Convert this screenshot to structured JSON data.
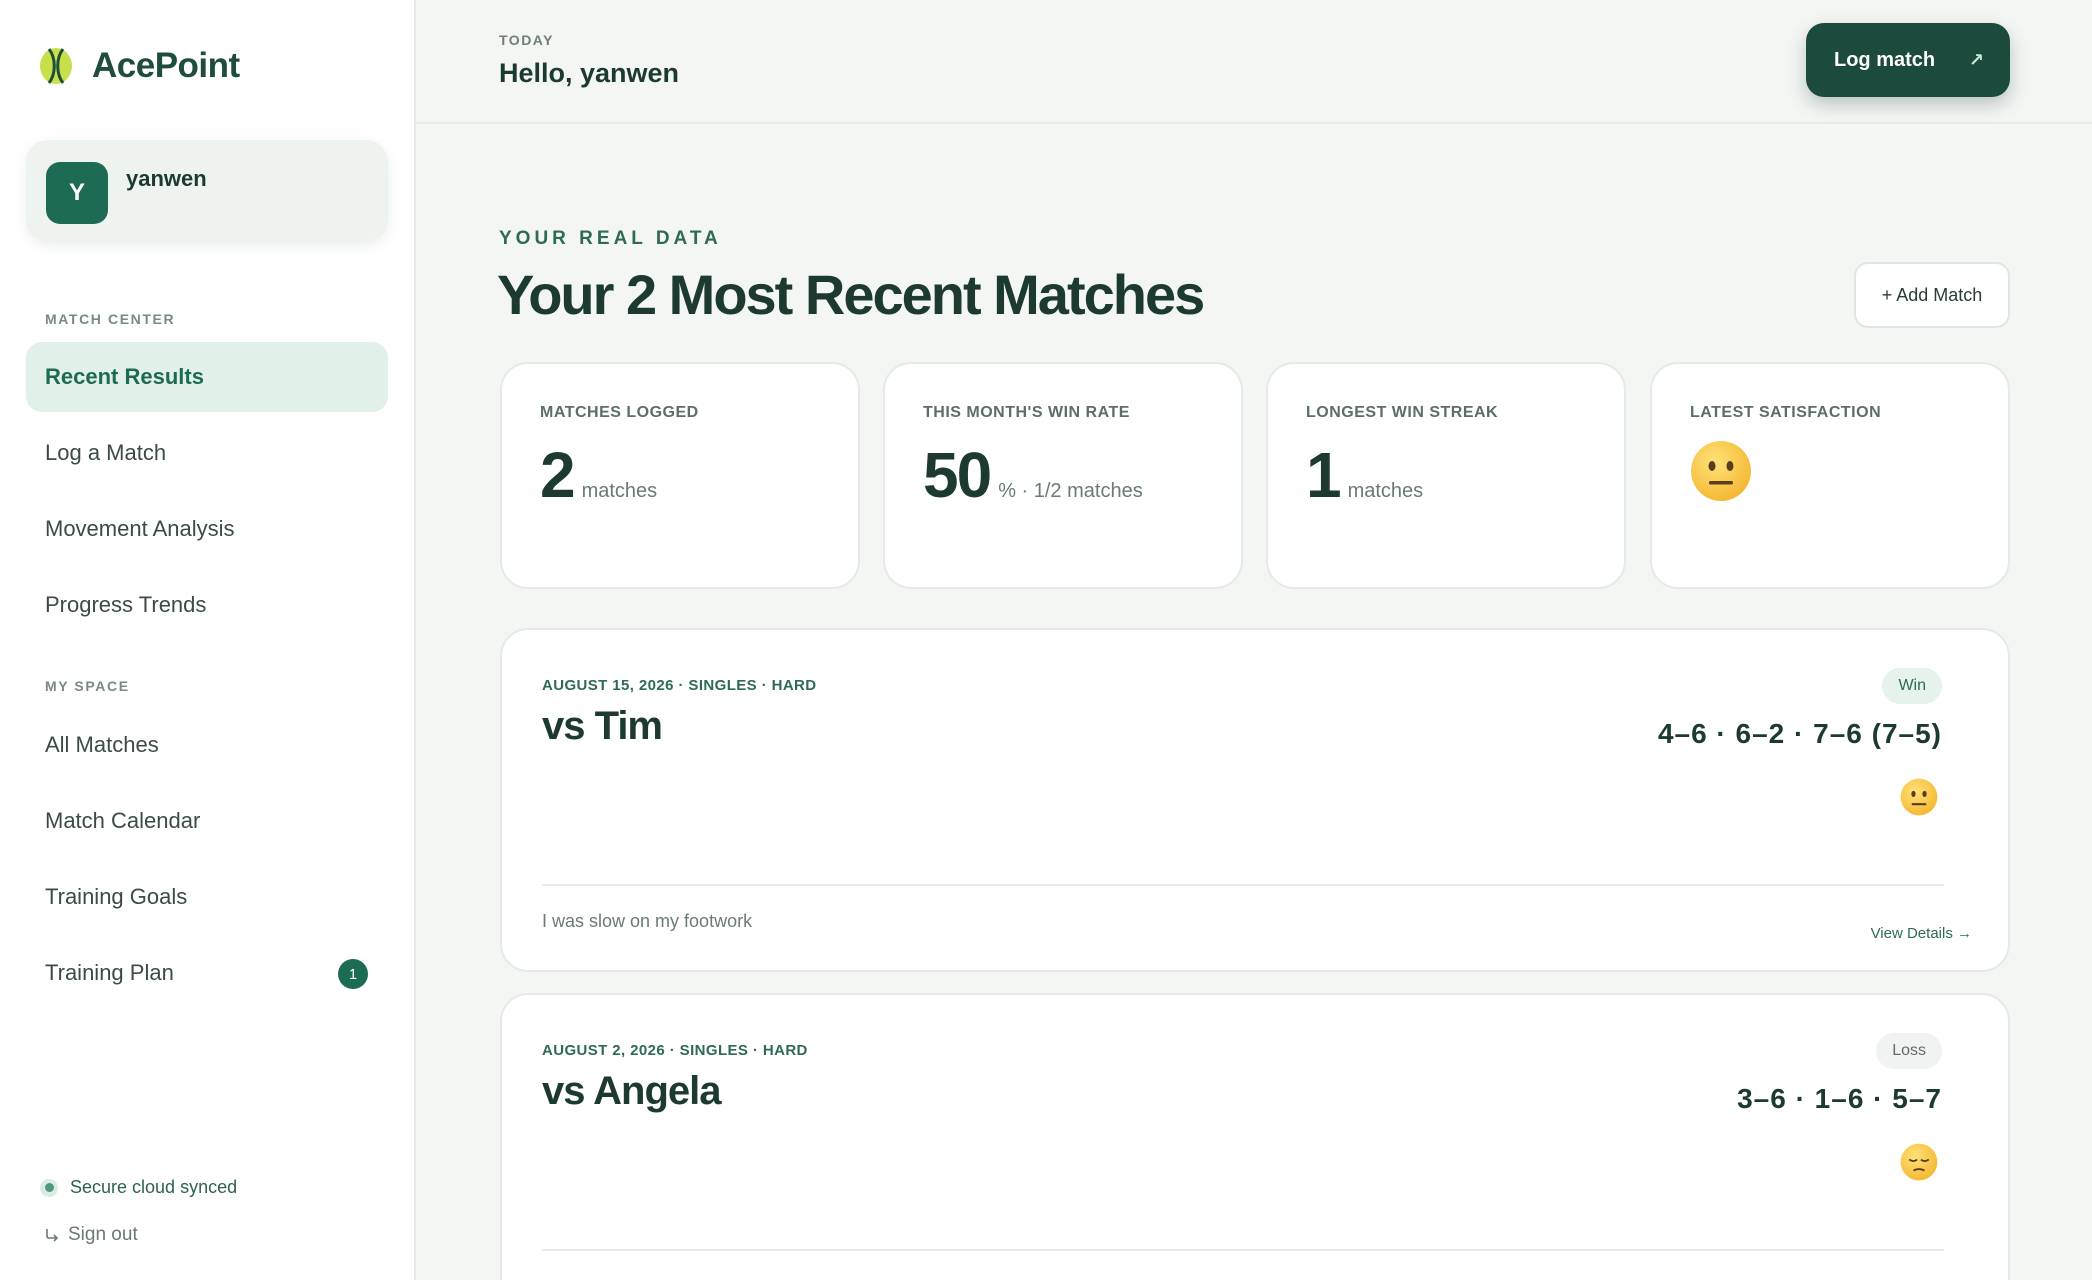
{
  "app": {
    "name": "AcePoint"
  },
  "user": {
    "initial": "Y",
    "name": "yanwen"
  },
  "sidebar": {
    "sections": [
      {
        "label": "MATCH CENTER",
        "items": [
          {
            "label": "Recent Results",
            "active": true
          },
          {
            "label": "Log a Match"
          },
          {
            "label": "Movement Analysis"
          },
          {
            "label": "Progress Trends"
          }
        ]
      },
      {
        "label": "MY SPACE",
        "items": [
          {
            "label": "All Matches"
          },
          {
            "label": "Match Calendar"
          },
          {
            "label": "Training Goals"
          },
          {
            "label": "Training Plan",
            "badge": "1"
          }
        ]
      }
    ],
    "sync_status": "Secure cloud synced",
    "sign_out": "Sign out"
  },
  "header": {
    "eyebrow": "TODAY",
    "greeting": "Hello, yanwen",
    "log_button": "Log match",
    "log_button_icon": "↗"
  },
  "main": {
    "eyebrow": "YOUR REAL DATA",
    "title": "Your 2 Most Recent Matches",
    "add_button": "+ Add Match"
  },
  "stats": [
    {
      "label": "MATCHES LOGGED",
      "value": "2",
      "unit": "matches"
    },
    {
      "label": "THIS MONTH'S WIN RATE",
      "value": "50",
      "unit": "% · 1/2 matches"
    },
    {
      "label": "LONGEST WIN STREAK",
      "value": "1",
      "unit": "matches"
    },
    {
      "label": "LATEST SATISFACTION",
      "icon": "neutral-face-emoji"
    }
  ],
  "matches": [
    {
      "meta": "AUGUST 15, 2026 · SINGLES · HARD",
      "opponent": "vs Tim",
      "result": "Win",
      "score": "4–6 · 6–2 · 7–6 (7–5)",
      "mood_icon": "neutral-face-emoji",
      "note": "I was slow on my footwork",
      "link": "View Details →"
    },
    {
      "meta": "AUGUST 2, 2026 · SINGLES · HARD",
      "opponent": "vs Angela",
      "result": "Loss",
      "score": "3–6 · 1–6 · 5–7",
      "mood_icon": "pensive-face-emoji"
    }
  ],
  "colors": {
    "brand": "#1e4d3c",
    "accent": "#1e6b55",
    "active_nav_bg": "#e1f0e8",
    "background": "#f4f6f4"
  }
}
